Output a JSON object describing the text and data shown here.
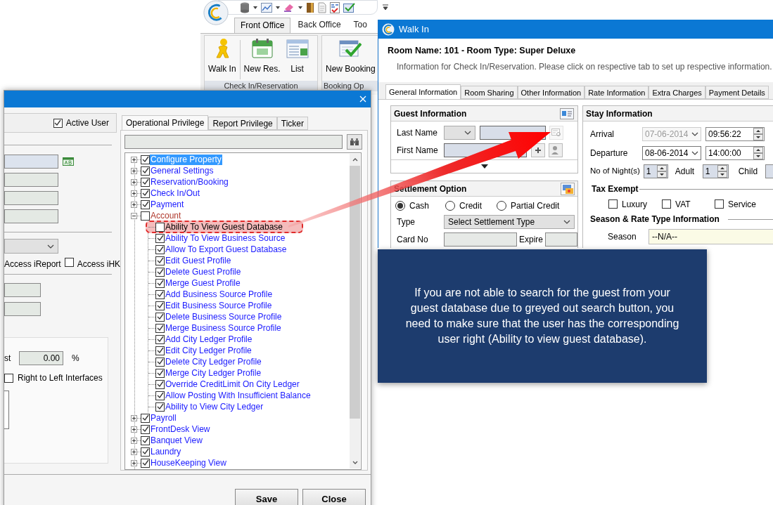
{
  "app": {
    "tabs": [
      {
        "label": "Front Office",
        "selected": true
      },
      {
        "label": "Back Office",
        "selected": false
      },
      {
        "label": "Too",
        "selected": false
      }
    ],
    "ribbon_groups": [
      {
        "label": "Check In/Reservation",
        "buttons": [
          "Walk In",
          "New Res.",
          "List"
        ]
      },
      {
        "label": "Booking Op",
        "buttons": [
          "New Booking"
        ]
      }
    ]
  },
  "user_dialog": {
    "active_user": {
      "label": "Active User",
      "checked": true
    },
    "access_ireport": "Access iReport",
    "access_ihk": {
      "label": "Access iHK",
      "checked": false
    },
    "discount_label": "st",
    "discount_value": "0.00",
    "percent": "%",
    "rtl": {
      "label": "Right to Left Interfaces",
      "checked": false
    },
    "privilege_tabs": [
      {
        "label": "Operational Privilege",
        "selected": true
      },
      {
        "label": "Report Privilege",
        "selected": false
      },
      {
        "label": "Ticker",
        "selected": false
      }
    ],
    "tree": [
      {
        "label": "Configure Property",
        "checked": true,
        "expanded": false,
        "selected": true
      },
      {
        "label": "General Settings",
        "checked": true,
        "expanded": false,
        "selected": false
      },
      {
        "label": "Reservation/Booking",
        "checked": true,
        "expanded": false,
        "selected": false
      },
      {
        "label": "Check In/Out",
        "checked": true,
        "expanded": false,
        "selected": false
      },
      {
        "label": "Payment",
        "checked": true,
        "expanded": false,
        "selected": false
      },
      {
        "label": "Account",
        "checked": false,
        "expanded": true,
        "selected": false,
        "children": [
          {
            "label": "Ability To View Guest Database",
            "checked": false,
            "selected": false,
            "highlighted": true
          },
          {
            "label": "Ability To View Business Source",
            "checked": true,
            "selected": false,
            "highlighted": false
          },
          {
            "label": "Allow To Export Guest Database",
            "checked": true,
            "selected": false,
            "highlighted": false
          },
          {
            "label": "Edit Guest Profile",
            "checked": true,
            "selected": false,
            "highlighted": false
          },
          {
            "label": "Delete Guest Profile",
            "checked": true,
            "selected": false,
            "highlighted": false
          },
          {
            "label": "Merge Guest Profile",
            "checked": true,
            "selected": false,
            "highlighted": false
          },
          {
            "label": "Add Business Source Profile",
            "checked": true,
            "selected": false,
            "highlighted": false
          },
          {
            "label": "Edit Business Source Profile",
            "checked": true,
            "selected": false,
            "highlighted": false
          },
          {
            "label": "Delete Business Source Profile",
            "checked": true,
            "selected": false,
            "highlighted": false
          },
          {
            "label": "Merge Business Source Profile",
            "checked": true,
            "selected": false,
            "highlighted": false
          },
          {
            "label": "Add City Ledger Profile",
            "checked": true,
            "selected": false,
            "highlighted": false
          },
          {
            "label": "Edit City Ledger Profile",
            "checked": true,
            "selected": false,
            "highlighted": false
          },
          {
            "label": "Delete City Ledger Profile",
            "checked": true,
            "selected": false,
            "highlighted": false
          },
          {
            "label": "Merge City Ledger Profile",
            "checked": true,
            "selected": false,
            "highlighted": false
          },
          {
            "label": "Override CreditLimit On City Ledger",
            "checked": true,
            "selected": false,
            "highlighted": false
          },
          {
            "label": "Allow Posting With Insufficient Balance",
            "checked": true,
            "selected": false,
            "highlighted": false
          },
          {
            "label": "Ability to View City Ledger",
            "checked": true,
            "selected": false,
            "highlighted": false
          }
        ]
      },
      {
        "label": "Payroll",
        "checked": true,
        "expanded": false,
        "selected": false
      },
      {
        "label": "FrontDesk View",
        "checked": true,
        "expanded": false,
        "selected": false
      },
      {
        "label": "Banquet View",
        "checked": true,
        "expanded": false,
        "selected": false
      },
      {
        "label": "Laundry",
        "checked": true,
        "expanded": false,
        "selected": false
      },
      {
        "label": "HouseKeeping View",
        "checked": true,
        "expanded": false,
        "selected": false
      }
    ],
    "buttons": [
      "Save",
      "Close"
    ]
  },
  "walk_in": {
    "title": "Walk In",
    "room": "Room Name: 101 - Room Type: Super Deluxe",
    "hint": "Information for Check In/Reservation. Please click on respective tab to set up respective information.",
    "tabs": [
      {
        "label": "General Information",
        "selected": true
      },
      {
        "label": "Room Sharing",
        "selected": false
      },
      {
        "label": "Other Information",
        "selected": false
      },
      {
        "label": "Rate Information",
        "selected": false
      },
      {
        "label": "Extra Charges",
        "selected": false
      },
      {
        "label": "Payment Details",
        "selected": false
      }
    ],
    "guest": {
      "title": "Guest Information",
      "last_name": "Last Name",
      "first_name": "First Name",
      "search_disabled": true
    },
    "settlement": {
      "title": "Settlement Option",
      "options": [
        {
          "label": "Cash",
          "selected": true
        },
        {
          "label": "Credit",
          "selected": false
        },
        {
          "label": "Partial Credit",
          "selected": false
        }
      ],
      "type_label": "Type",
      "type_value": "Select Settlement Type",
      "card_no": "Card No",
      "expire": "Expire"
    },
    "stay": {
      "title": "Stay Information",
      "dates": [
        {
          "label": "Arrival",
          "date": "07-06-2014",
          "disabled": true,
          "time": "09:56:22"
        },
        {
          "label": "Departure",
          "date": "08-06-2014",
          "disabled": false,
          "time": "14:00:00"
        }
      ],
      "nights": {
        "label": "No of Night(s)",
        "value": "1"
      },
      "adult": {
        "label": "Adult",
        "value": "1"
      },
      "child": {
        "label": "Child"
      },
      "tax_exempt": {
        "title": "Tax Exempt",
        "options": [
          {
            "label": "Luxury",
            "checked": false
          },
          {
            "label": "VAT",
            "checked": false
          },
          {
            "label": "Service",
            "checked": false
          }
        ]
      },
      "season_title": "Season & Rate Type Information",
      "season": {
        "label": "Season",
        "value": "--N/A--"
      }
    }
  },
  "callout": "If you are not able to search for the guest from your guest database due to greyed out search button, you need to make sure that the user has the corresponding user right (Ability to view guest database)."
}
